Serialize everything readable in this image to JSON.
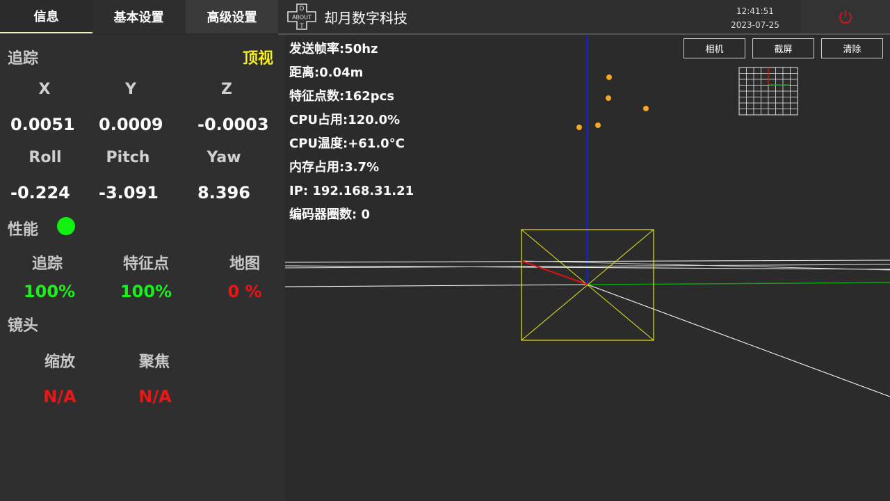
{
  "tabs": [
    {
      "label": "信息"
    },
    {
      "label": "基本设置"
    },
    {
      "label": "高级设置"
    }
  ],
  "brand": {
    "logo_text": "ABOUT",
    "logo_letters": "D T",
    "title": "却月数字科技"
  },
  "clock": {
    "time": "12:41:51",
    "date": "2023-07-25"
  },
  "tracking": {
    "title": "追踪",
    "view_mode": "顶视",
    "headers_pos": [
      "X",
      "Y",
      "Z"
    ],
    "values_pos": [
      "0.0051",
      "0.0009",
      "-0.0003"
    ],
    "headers_rot": [
      "Roll",
      "Pitch",
      "Yaw"
    ],
    "values_rot": [
      "-0.224",
      "-3.091",
      "8.396"
    ]
  },
  "performance": {
    "title": "性能",
    "status_color": "#11f011",
    "items": [
      {
        "label": "追踪",
        "value": "100%",
        "color": "#1bf01b"
      },
      {
        "label": "特征点",
        "value": "100%",
        "color": "#1bf01b"
      },
      {
        "label": "地图",
        "value": "0 %",
        "color": "#ee1515"
      }
    ]
  },
  "lens": {
    "title": "镜头",
    "items": [
      {
        "label": "缩放",
        "value": "N/A"
      },
      {
        "label": "聚焦",
        "value": "N/A"
      }
    ]
  },
  "stats": [
    "发送帧率:50hz",
    "距离:0.04m",
    "特征点数:162pcs",
    "CPU占用:120.0%",
    "CPU温度:+61.0°C",
    "内存占用:3.7%",
    "IP: 192.168.31.21",
    "编码器圈数: 0"
  ],
  "viewport_buttons": {
    "camera": "相机",
    "screenshot": "截屏",
    "clear": "清除"
  },
  "colors": {
    "accent_yellow": "#f5f01e",
    "ok_green": "#1bf01b",
    "error_red": "#ee1515",
    "feature_point": "#f5a623"
  },
  "icons": {
    "power": "power-icon",
    "logo": "dpad-logo-icon"
  }
}
